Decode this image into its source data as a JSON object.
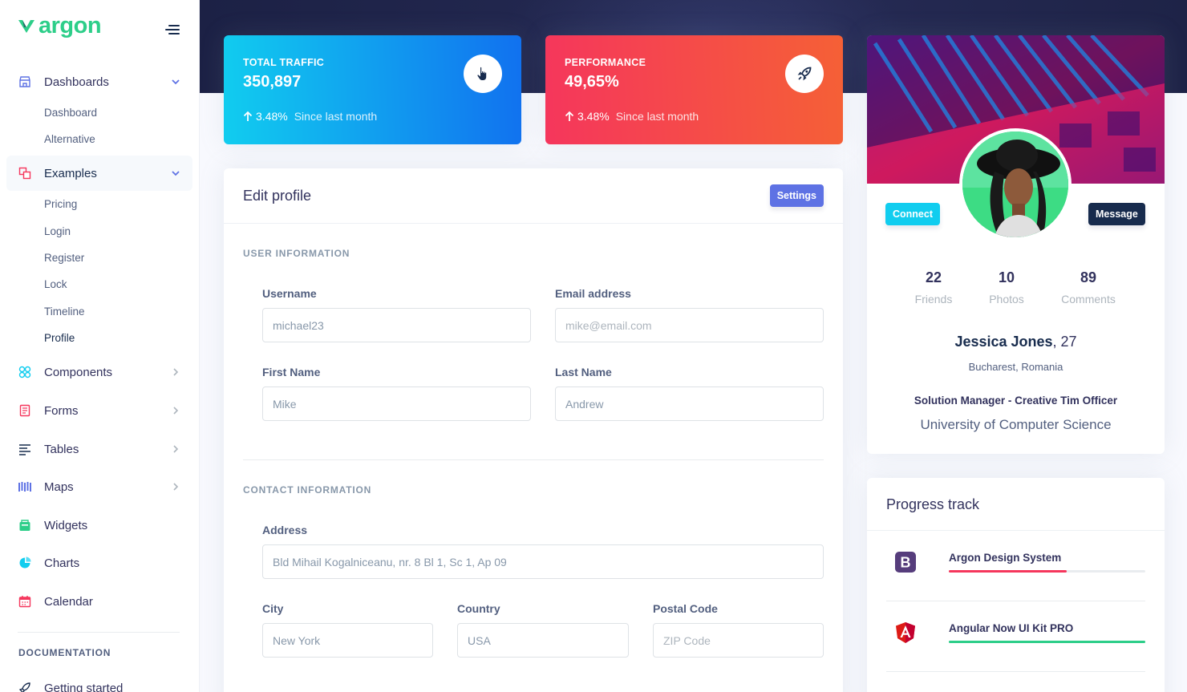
{
  "brand": {
    "name": "argon"
  },
  "sidebar": {
    "items": [
      {
        "label": "Dashboards",
        "icon": "shop-icon",
        "color": "#5e72e4",
        "expanded": true
      },
      {
        "label": "Examples",
        "icon": "ungroup-icon",
        "color": "#f5365c",
        "expanded": true
      },
      {
        "label": "Components",
        "icon": "components-icon",
        "color": "#11cdef"
      },
      {
        "label": "Forms",
        "icon": "forms-icon",
        "color": "#f5365c"
      },
      {
        "label": "Tables",
        "icon": "tables-icon",
        "color": "#172b4d"
      },
      {
        "label": "Maps",
        "icon": "maps-icon",
        "color": "#5e72e4"
      },
      {
        "label": "Widgets",
        "icon": "widgets-icon",
        "color": "#2dce89"
      },
      {
        "label": "Charts",
        "icon": "charts-icon",
        "color": "#11cdef"
      },
      {
        "label": "Calendar",
        "icon": "calendar-icon",
        "color": "#f5365c"
      }
    ],
    "dashboards_sub": [
      "Dashboard",
      "Alternative"
    ],
    "examples_sub": [
      "Pricing",
      "Login",
      "Register",
      "Lock",
      "Timeline",
      "Profile"
    ],
    "documentation_heading": "DOCUMENTATION",
    "getting_started": "Getting started"
  },
  "stats": [
    {
      "title": "TOTAL TRAFFIC",
      "value": "350,897",
      "change": "3.48%",
      "since": "Since last month",
      "icon": "hand-pointer-icon"
    },
    {
      "title": "PERFORMANCE",
      "value": "49,65%",
      "change": "3.48%",
      "since": "Since last month",
      "icon": "rocket-icon"
    }
  ],
  "edit_profile": {
    "title": "Edit profile",
    "settings_button": "Settings",
    "user_info_heading": "USER INFORMATION",
    "username_label": "Username",
    "username_value": "michael23",
    "email_label": "Email address",
    "email_placeholder": "mike@email.com",
    "first_name_label": "First Name",
    "first_name_value": "Mike",
    "last_name_label": "Last Name",
    "last_name_value": "Andrew",
    "contact_heading": "CONTACT INFORMATION",
    "address_label": "Address",
    "address_value": "Bld Mihail Kogalniceanu, nr. 8 Bl 1, Sc 1, Ap 09",
    "city_label": "City",
    "city_value": "New York",
    "country_label": "Country",
    "country_value": "USA",
    "postal_label": "Postal Code",
    "postal_placeholder": "ZIP Code"
  },
  "profile": {
    "connect_button": "Connect",
    "message_button": "Message",
    "friends_count": "22",
    "friends_label": "Friends",
    "photos_count": "10",
    "photos_label": "Photos",
    "comments_count": "89",
    "comments_label": "Comments",
    "name": "Jessica Jones",
    "age": ", 27",
    "location": "Bucharest, Romania",
    "job": "Solution Manager - Creative Tim Officer",
    "university": "University of Computer Science"
  },
  "progress": {
    "title": "Progress track",
    "items": [
      {
        "name": "Argon Design System",
        "progress": 0.6,
        "color": "#f5365c",
        "logo": "bootstrap-logo-icon"
      },
      {
        "name": "Angular Now UI Kit PRO",
        "progress": 1.0,
        "color": "#2dce89",
        "logo": "angular-logo-icon"
      }
    ]
  }
}
